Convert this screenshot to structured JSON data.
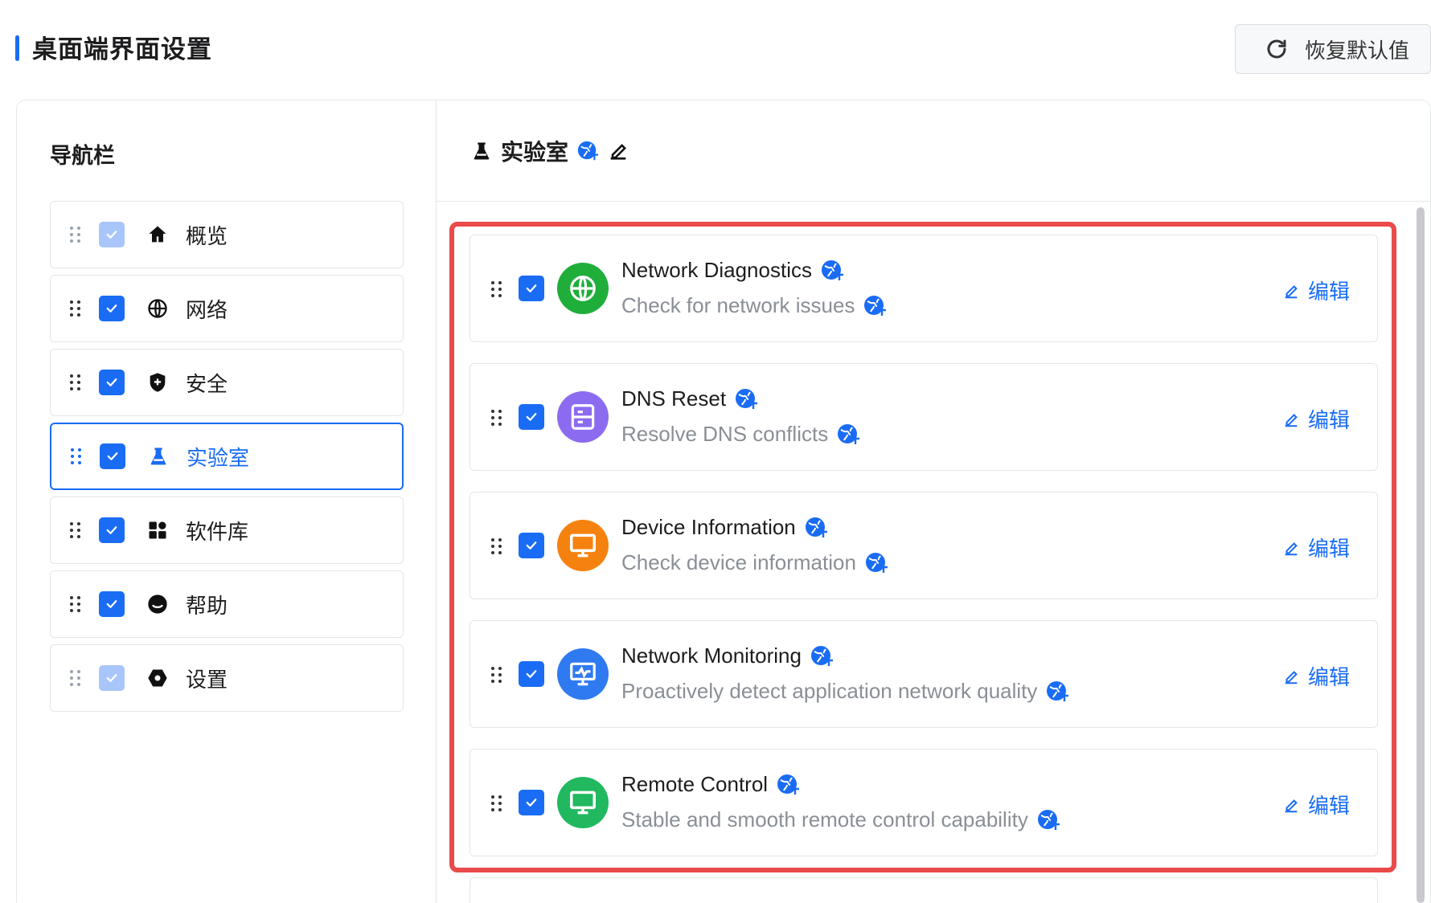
{
  "page": {
    "title": "桌面端界面设置",
    "reset_label": "恢复默认值"
  },
  "nav": {
    "heading": "导航栏",
    "items": [
      {
        "label": "概览",
        "icon": "home-icon",
        "checked": true,
        "locked": true,
        "active": false
      },
      {
        "label": "网络",
        "icon": "globe-icon",
        "checked": true,
        "locked": false,
        "active": false
      },
      {
        "label": "安全",
        "icon": "shield-icon",
        "checked": true,
        "locked": false,
        "active": false
      },
      {
        "label": "实验室",
        "icon": "flask-icon",
        "checked": true,
        "locked": false,
        "active": true
      },
      {
        "label": "软件库",
        "icon": "apps-icon",
        "checked": true,
        "locked": false,
        "active": false
      },
      {
        "label": "帮助",
        "icon": "help-icon",
        "checked": true,
        "locked": false,
        "active": false
      },
      {
        "label": "设置",
        "icon": "settings-icon",
        "checked": true,
        "locked": true,
        "active": false
      }
    ]
  },
  "lab": {
    "heading": "实验室",
    "edit_label": "编辑",
    "items": [
      {
        "title": "Network Diagnostics",
        "desc": "Check for network issues",
        "icon": "globe-icon",
        "color": "#1fae3a"
      },
      {
        "title": "DNS Reset",
        "desc": "Resolve DNS conflicts",
        "icon": "server-icon",
        "color": "#8b6cf0"
      },
      {
        "title": "Device Information",
        "desc": "Check device information",
        "icon": "monitor-icon",
        "color": "#f5820f"
      },
      {
        "title": "Network Monitoring",
        "desc": "Proactively detect application network quality",
        "icon": "pulse-monitor-icon",
        "color": "#2f7af0"
      },
      {
        "title": "Remote Control",
        "desc": "Stable and smooth remote control capability",
        "icon": "monitor-icon",
        "color": "#22b860"
      }
    ]
  },
  "colors": {
    "accent": "#1a6cf5",
    "highlight_border": "#ea4a4a"
  }
}
